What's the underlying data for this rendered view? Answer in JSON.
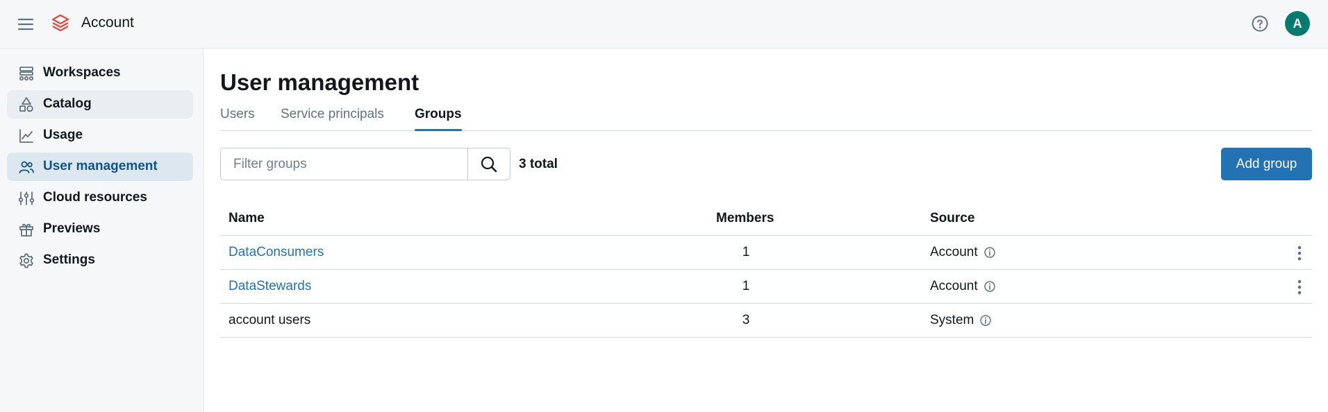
{
  "header": {
    "app_title": "Account",
    "avatar_initial": "A",
    "icons": [
      "hamburger-menu-icon",
      "databricks-logo-icon",
      "help-icon"
    ]
  },
  "sidebar": {
    "items": [
      {
        "label": "Workspaces",
        "icon": "workspaces-icon"
      },
      {
        "label": "Catalog",
        "icon": "catalog-icon"
      },
      {
        "label": "Usage",
        "icon": "usage-chart-icon"
      },
      {
        "label": "User management",
        "icon": "users-icon",
        "active": true
      },
      {
        "label": "Cloud resources",
        "icon": "sliders-icon"
      },
      {
        "label": "Previews",
        "icon": "gift-icon"
      },
      {
        "label": "Settings",
        "icon": "gear-icon"
      }
    ]
  },
  "main": {
    "title": "User management",
    "tabs": [
      {
        "label": "Users"
      },
      {
        "label": "Service principals"
      },
      {
        "label": "Groups",
        "active": true
      }
    ],
    "search": {
      "placeholder": "Filter groups",
      "value": ""
    },
    "total": "3 total",
    "add_button": "Add group",
    "table": {
      "headers": {
        "name": "Name",
        "members": "Members",
        "source": "Source"
      },
      "rows": [
        {
          "name": "DataConsumers",
          "members": "1",
          "source": "Account"
        },
        {
          "name": "DataStewards",
          "members": "1",
          "source": "Account"
        },
        {
          "name": "account users",
          "members": "3",
          "source": "System"
        }
      ]
    }
  },
  "colors": {
    "accent": "#2272b4",
    "avatar": "#077a6f",
    "logo": "#e2493b",
    "sidebar_active": "#dde7f0"
  }
}
